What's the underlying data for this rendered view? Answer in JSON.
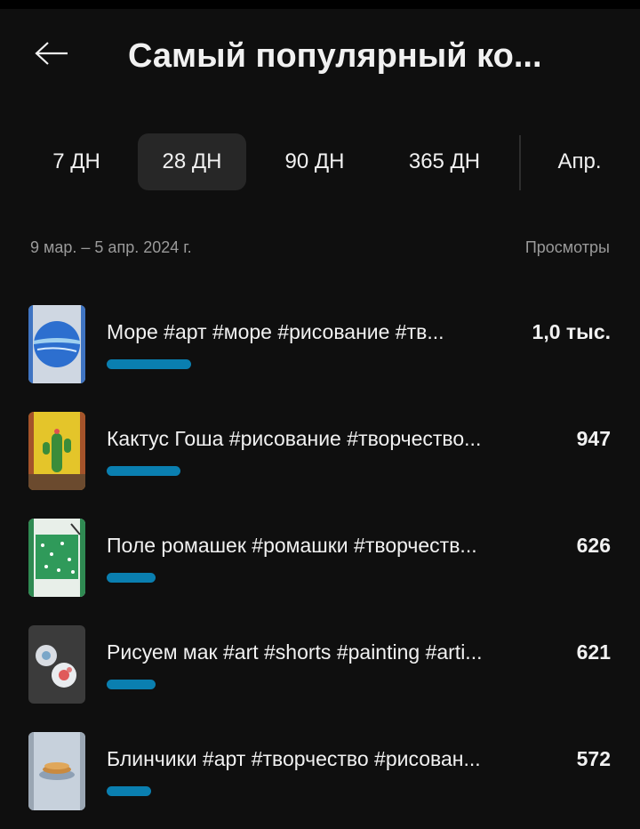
{
  "header": {
    "title": "Самый популярный ко..."
  },
  "tabs": [
    {
      "label": "7 ДН",
      "active": false
    },
    {
      "label": "28 ДН",
      "active": true
    },
    {
      "label": "90 ДН",
      "active": false
    },
    {
      "label": "365 ДН",
      "active": false
    },
    {
      "label": "Апр.",
      "active": false
    }
  ],
  "summary": {
    "date_range": "9 мар. – 5 апр. 2024 г.",
    "metric_label": "Просмотры"
  },
  "videos": [
    {
      "title": "Море #арт #море #рисование #тв...",
      "views": "1,0 тыс.",
      "relative_share": 0.095,
      "thumbnail": "blue-sea-circle-painting"
    },
    {
      "title": "Кактус Гоша #рисование #творчество...",
      "views": "947",
      "relative_share": 0.083,
      "thumbnail": "yellow-cactus-painting"
    },
    {
      "title": "Поле ромашек #ромашки #творчеств...",
      "views": "626",
      "relative_share": 0.055,
      "thumbnail": "green-daisy-field-painting"
    },
    {
      "title": "Рисуем мак #art #shorts #painting #arti...",
      "views": "621",
      "relative_share": 0.055,
      "thumbnail": "poppy-round-painting"
    },
    {
      "title": "Блинчики #арт #творчество #рисован...",
      "views": "572",
      "relative_share": 0.05,
      "thumbnail": "pancakes-painting"
    }
  ],
  "colors": {
    "background": "#0f0f0f",
    "bar": "#0a7fb0",
    "active_tab": "#272727",
    "muted_text": "#9a9a9a"
  }
}
